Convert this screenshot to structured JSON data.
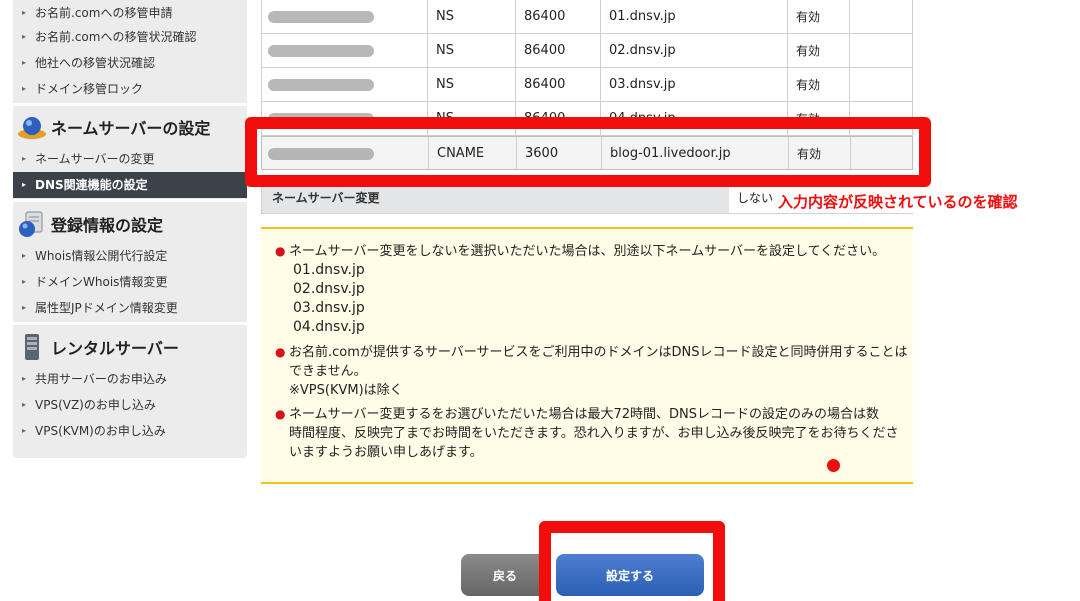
{
  "sidebar": {
    "migration_items": [
      {
        "label": "お名前.comへの移管申請"
      },
      {
        "label": "お名前.comへの移管状況確認"
      },
      {
        "label": "他社への移管状況確認"
      },
      {
        "label": "ドメイン移管ロック"
      }
    ],
    "nameserver_section": {
      "title": "ネームサーバーの設定",
      "items": [
        {
          "label": "ネームサーバーの変更"
        },
        {
          "label": "DNS関連機能の設定",
          "active": true
        }
      ]
    },
    "registration_section": {
      "title": "登録情報の設定",
      "items": [
        {
          "label": "Whois情報公開代行設定"
        },
        {
          "label": "ドメインWhois情報変更"
        },
        {
          "label": "属性型JPドメイン情報変更"
        }
      ]
    },
    "rental_section": {
      "title": "レンタルサーバー",
      "items": [
        {
          "label": "共用サーバーのお申込み"
        },
        {
          "label": "VPS(VZ)のお申し込み"
        },
        {
          "label": "VPS(KVM)のお申し込み"
        }
      ]
    }
  },
  "records": [
    {
      "type": "NS",
      "ttl": "86400",
      "value": "01.dnsv.jp",
      "status": "有効"
    },
    {
      "type": "NS",
      "ttl": "86400",
      "value": "02.dnsv.jp",
      "status": "有効"
    },
    {
      "type": "NS",
      "ttl": "86400",
      "value": "03.dnsv.jp",
      "status": "有効"
    },
    {
      "type": "NS",
      "ttl": "86400",
      "value": "04.dnsv.jp",
      "status": "有効"
    },
    {
      "type": "CNAME",
      "ttl": "3600",
      "value": "blog-01.livedoor.jp",
      "status": "有効"
    }
  ],
  "nameserver_change": {
    "label": "ネームサーバー変更",
    "value": "しない"
  },
  "notices": {
    "note1": "ネームサーバー変更をしないを選択いただいた場合は、別途以下ネームサーバーを設定してください。",
    "dns_list": [
      "01.dnsv.jp",
      "02.dnsv.jp",
      "03.dnsv.jp",
      "04.dnsv.jp"
    ],
    "note2_line1": "お名前.comが提供するサーバーサービスをご利用中のドメインはDNSレコード設定と同時併用することは",
    "note2_line2": "できません。",
    "note2_line3": "※VPS(KVM)は除く",
    "note3_line1": "ネームサーバー変更するをお選びいただいた場合は最大72時間、DNSレコードの設定のみの場合は数",
    "note3_line2": "時間程度、反映完了までお時間をいただきます。恐れ入りますが、お申し込み後反映完了をお待ちくださ",
    "note3_line3": "いますようお願い申しあげます。"
  },
  "buttons": {
    "back": "戻る",
    "submit": "設定する"
  },
  "annotation": "入力内容が反映されているのを確認",
  "colors": {
    "annotation_red": "#f20d0d",
    "active_nav": "#3b4249",
    "submit_blue": "#2b5fb4",
    "notice_border": "#f5c21a"
  }
}
